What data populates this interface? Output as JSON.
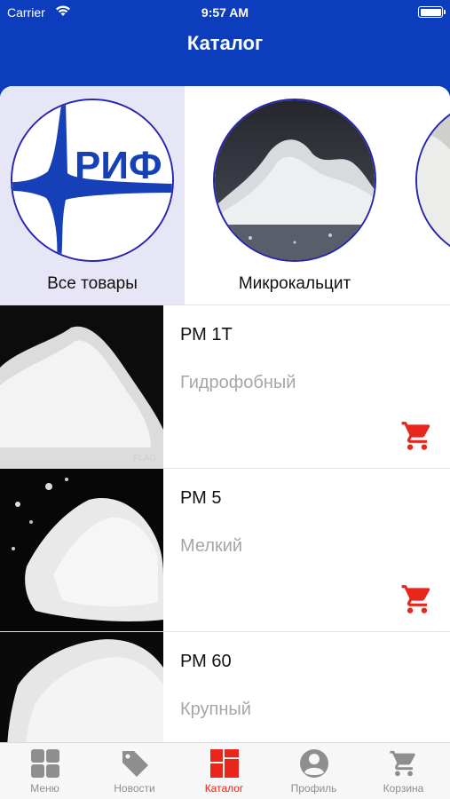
{
  "status_bar": {
    "carrier": "Carrier",
    "time": "9:57 AM"
  },
  "nav": {
    "title": "Каталог"
  },
  "categories": [
    {
      "label": "Все товары",
      "icon": "rif-logo",
      "active": true
    },
    {
      "label": "Микрокальцит",
      "icon": "powder-photo",
      "active": false
    },
    {
      "label": "",
      "icon": "powder-photo",
      "active": false
    }
  ],
  "products": [
    {
      "name": "РМ 1Т",
      "description": "Гидрофобный",
      "image_caption": "FLAG"
    },
    {
      "name": "РМ 5",
      "description": "Мелкий"
    },
    {
      "name": "РМ 60",
      "description": "Крупный"
    }
  ],
  "tabs": [
    {
      "label": "Меню",
      "icon": "grid-icon",
      "active": false
    },
    {
      "label": "Новости",
      "icon": "tag-icon",
      "active": false
    },
    {
      "label": "Каталог",
      "icon": "catalog-icon",
      "active": true
    },
    {
      "label": "Профиль",
      "icon": "profile-icon",
      "active": false
    },
    {
      "label": "Корзина",
      "icon": "cart-icon",
      "active": false
    }
  ],
  "colors": {
    "brand_blue": "#0b3dbd",
    "accent_red": "#e8261c",
    "tab_inactive": "#8e8e8e"
  }
}
